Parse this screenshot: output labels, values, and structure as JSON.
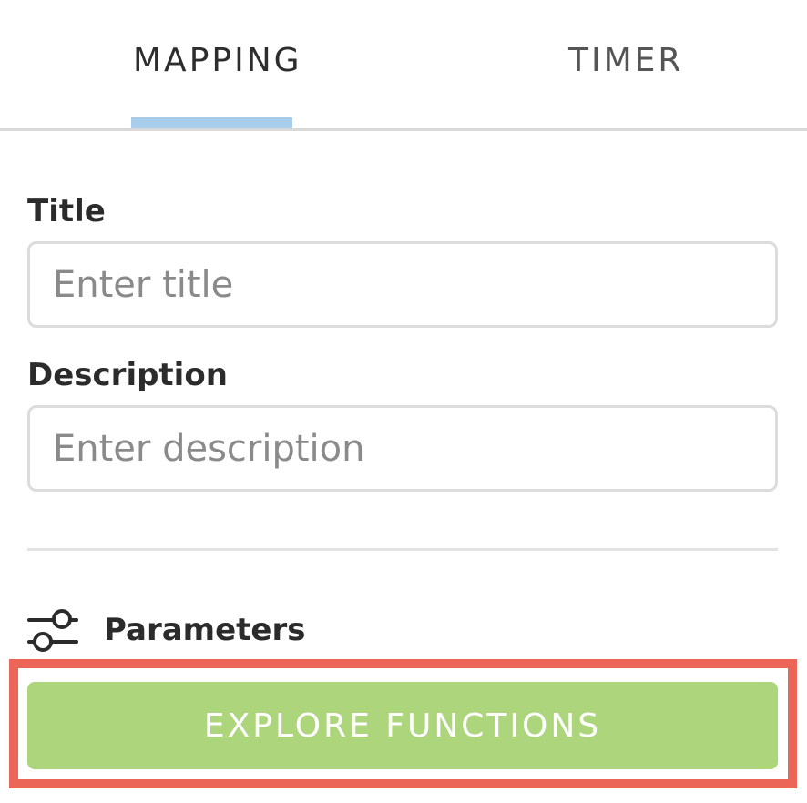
{
  "tabs": [
    {
      "label": "MAPPING",
      "active": true
    },
    {
      "label": "TIMER",
      "active": false
    }
  ],
  "form": {
    "title_label": "Title",
    "title_placeholder": "Enter title",
    "title_value": "",
    "description_label": "Description",
    "description_placeholder": "Enter description",
    "description_value": ""
  },
  "parameters": {
    "icon": "sliders-icon",
    "label": "Parameters"
  },
  "actions": {
    "explore_label": "EXPLORE FUNCTIONS"
  },
  "colors": {
    "tab_indicator": "#a8cdea",
    "explore_button": "#add57c",
    "highlight_border": "#ec6657"
  }
}
